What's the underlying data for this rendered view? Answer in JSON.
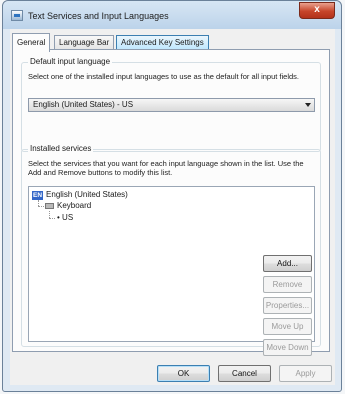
{
  "window": {
    "title": "Text Services and Input Languages",
    "close_label": "x"
  },
  "tabs": [
    {
      "label": "General"
    },
    {
      "label": "Language Bar"
    },
    {
      "label": "Advanced Key Settings"
    }
  ],
  "default_input": {
    "group_label": "Default input language",
    "description": "Select one of the installed input languages to use as the default for all input fields.",
    "selected": "English (United States) - US"
  },
  "installed": {
    "group_label": "Installed services",
    "description": "Select the services that you want for each input language shown in the list. Use the Add and Remove buttons to modify this list.",
    "tree": {
      "language_badge": "EN",
      "language": "English (United States)",
      "category": "Keyboard",
      "service": "US"
    },
    "buttons": {
      "add": "Add...",
      "remove": "Remove",
      "properties": "Properties...",
      "move_up": "Move Up",
      "move_down": "Move Down"
    }
  },
  "footer": {
    "ok": "OK",
    "cancel": "Cancel",
    "apply": "Apply"
  }
}
